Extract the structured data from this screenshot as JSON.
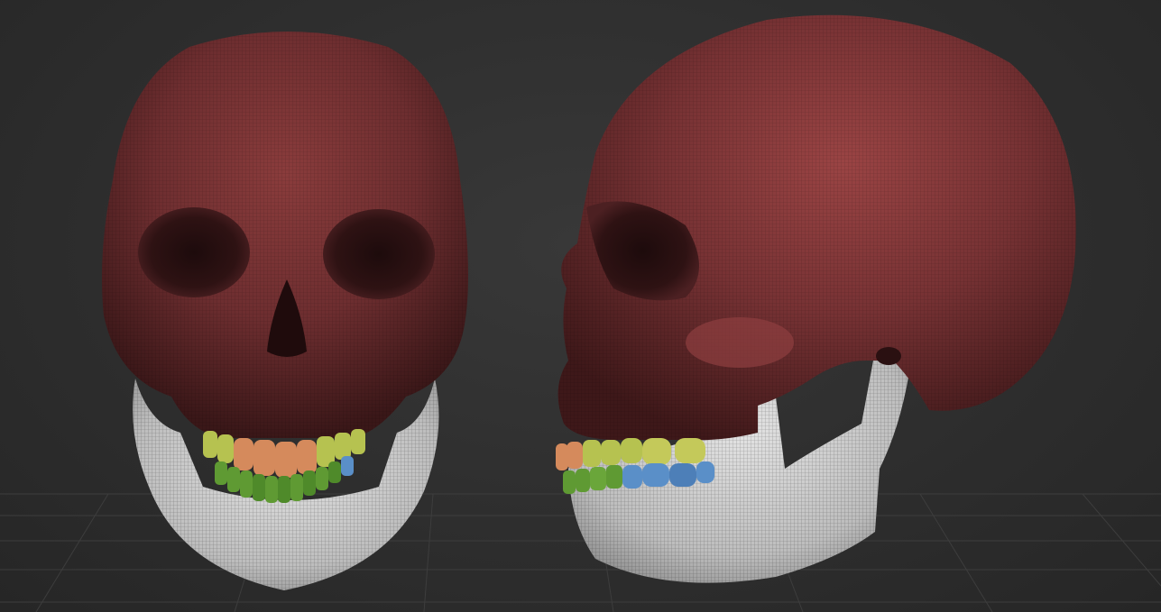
{
  "viewport": {
    "background_color": "#2f2f2f",
    "grid_visible": true,
    "grid_color": "#3d3d3d"
  },
  "model": {
    "name": "",
    "views": [
      {
        "view": "front"
      },
      {
        "view": "side"
      }
    ],
    "polygroup_colors": {
      "cranium": "#6e2e30",
      "cranium_highlight": "#8a3c3c",
      "mandible": "#d8d8d8",
      "teeth_upper_incisor": "#d58a5c",
      "teeth_upper_premolar": "#b6c250",
      "teeth_lower": "#5f9a33",
      "teeth_molar_lower": "#5a8fc8"
    }
  }
}
